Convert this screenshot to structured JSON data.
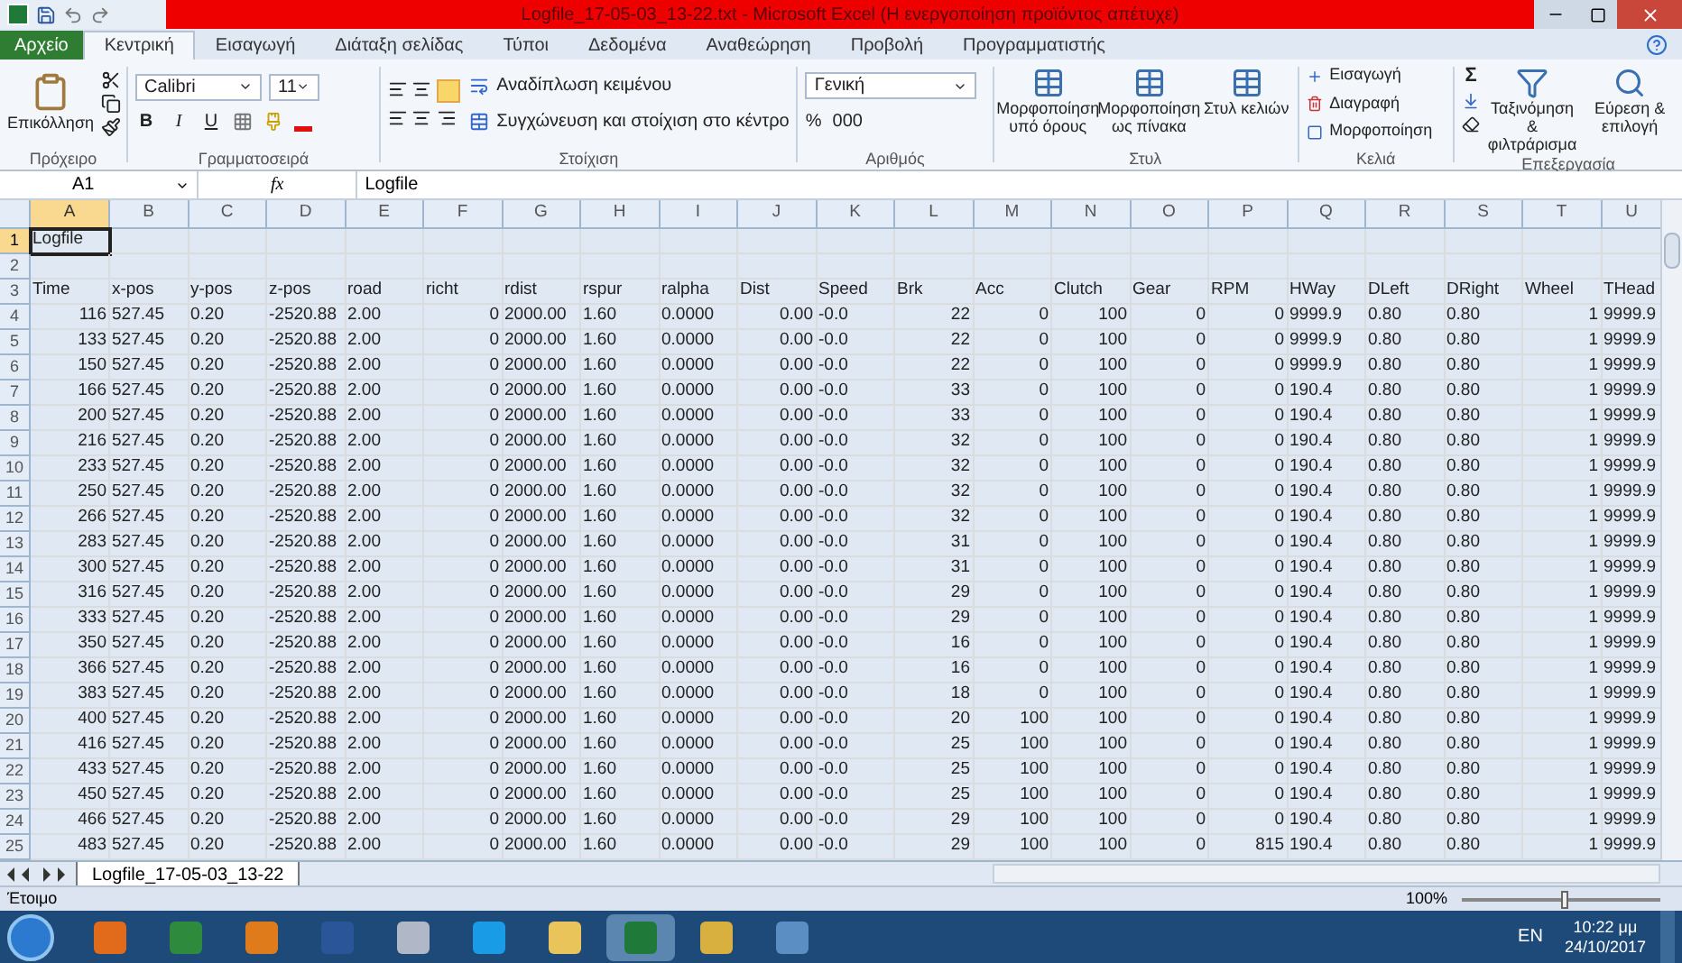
{
  "window": {
    "title": "Logfile_17-05-03_13-22.txt - Microsoft Excel (Η ενεργοποίηση προϊόντος απέτυχε)"
  },
  "ribbon": {
    "file_tab": "Αρχείο",
    "tabs": [
      {
        "label": "Κεντρική",
        "selected": true
      },
      {
        "label": "Εισαγωγή",
        "selected": false
      },
      {
        "label": "Διάταξη σελίδας",
        "selected": false
      },
      {
        "label": "Τύποι",
        "selected": false
      },
      {
        "label": "Δεδομένα",
        "selected": false
      },
      {
        "label": "Αναθεώρηση",
        "selected": false
      },
      {
        "label": "Προβολή",
        "selected": false
      },
      {
        "label": "Προγραμματιστής",
        "selected": false
      }
    ],
    "clipboard": {
      "paste": "Επικόλληση",
      "label": "Πρόχειρο"
    },
    "font": {
      "name": "Calibri",
      "size": "11",
      "bold": "B",
      "italic": "I",
      "underline": "U",
      "label": "Γραμματοσειρά"
    },
    "alignment": {
      "wrap": "Αναδίπλωση κειμένου",
      "merge": "Συγχώνευση και στοίχιση στο κέντρο",
      "label": "Στοίχιση"
    },
    "number": {
      "format": "Γενική",
      "percent": "%",
      "thousands": "000",
      "label": "Αριθμός"
    },
    "styles": {
      "buttons": [
        "Μορφοποίηση υπό όρους",
        "Μορφοποίηση ως πίνακα",
        "Στυλ κελιών"
      ],
      "label": "Στυλ"
    },
    "cells": {
      "buttons": [
        "Εισαγωγή",
        "Διαγραφή",
        "Μορφοποίηση"
      ],
      "label": "Κελιά"
    },
    "editing": {
      "sum": "Σ",
      "buttons": [
        "Ταξινόμηση & φιλτράρισμα",
        "Εύρεση & επιλογή"
      ],
      "label": "Επεξεργασία"
    }
  },
  "formula_bar": {
    "name_box": "A1",
    "fx": "fx",
    "value": "Logfile"
  },
  "sheet": {
    "columns": [
      {
        "letter": "A",
        "selected": true
      },
      {
        "letter": "B",
        "selected": false
      },
      {
        "letter": "C",
        "selected": false
      },
      {
        "letter": "D",
        "selected": false
      },
      {
        "letter": "E",
        "selected": false
      },
      {
        "letter": "F",
        "selected": false
      },
      {
        "letter": "G",
        "selected": false
      },
      {
        "letter": "H",
        "selected": false
      },
      {
        "letter": "I",
        "selected": false
      },
      {
        "letter": "J",
        "selected": false
      },
      {
        "letter": "K",
        "selected": false
      },
      {
        "letter": "L",
        "selected": false
      },
      {
        "letter": "M",
        "selected": false
      },
      {
        "letter": "N",
        "selected": false
      },
      {
        "letter": "O",
        "selected": false
      },
      {
        "letter": "P",
        "selected": false
      },
      {
        "letter": "Q",
        "selected": false
      },
      {
        "letter": "R",
        "selected": false
      },
      {
        "letter": "S",
        "selected": false
      },
      {
        "letter": "T",
        "selected": false
      },
      {
        "letter": "U",
        "selected": false
      }
    ],
    "rows": [
      {
        "number": "1",
        "kind": "text",
        "selected": true,
        "cells": [
          "Logfile"
        ]
      },
      {
        "number": "2",
        "kind": "text",
        "selected": false
      },
      {
        "number": "3",
        "kind": "text",
        "selected": false,
        "cells": [
          "Time",
          "x-pos",
          "y-pos",
          "z-pos",
          "road",
          "richt",
          "rdist",
          "rspur",
          "ralpha",
          "Dist",
          "Speed",
          "Brk",
          "Acc",
          "Clutch",
          "Gear",
          "RPM",
          "HWay",
          "DLeft",
          "DRight",
          "Wheel",
          "THead"
        ]
      },
      {
        "number": "4",
        "kind": "data",
        "selected": false,
        "cells": [
          "116",
          "527.45",
          "0.20",
          "-2520.88",
          "2.00",
          "0",
          "2000.00",
          "1.60",
          "0.0000",
          "0.00",
          "-0.0",
          "22",
          "0",
          "100",
          "0",
          "0",
          "9999.9",
          "0.80",
          "0.80",
          "1",
          "9999.9"
        ]
      },
      {
        "number": "5",
        "kind": "data",
        "selected": false,
        "cells": [
          "133",
          "527.45",
          "0.20",
          "-2520.88",
          "2.00",
          "0",
          "2000.00",
          "1.60",
          "0.0000",
          "0.00",
          "-0.0",
          "22",
          "0",
          "100",
          "0",
          "0",
          "9999.9",
          "0.80",
          "0.80",
          "1",
          "9999.9"
        ]
      },
      {
        "number": "6",
        "kind": "data",
        "selected": false,
        "cells": [
          "150",
          "527.45",
          "0.20",
          "-2520.88",
          "2.00",
          "0",
          "2000.00",
          "1.60",
          "0.0000",
          "0.00",
          "-0.0",
          "22",
          "0",
          "100",
          "0",
          "0",
          "9999.9",
          "0.80",
          "0.80",
          "1",
          "9999.9"
        ]
      },
      {
        "number": "7",
        "kind": "data",
        "selected": false,
        "cells": [
          "166",
          "527.45",
          "0.20",
          "-2520.88",
          "2.00",
          "0",
          "2000.00",
          "1.60",
          "0.0000",
          "0.00",
          "-0.0",
          "33",
          "0",
          "100",
          "0",
          "0",
          "190.4",
          "0.80",
          "0.80",
          "1",
          "9999.9"
        ]
      },
      {
        "number": "8",
        "kind": "data",
        "selected": false,
        "cells": [
          "200",
          "527.45",
          "0.20",
          "-2520.88",
          "2.00",
          "0",
          "2000.00",
          "1.60",
          "0.0000",
          "0.00",
          "-0.0",
          "33",
          "0",
          "100",
          "0",
          "0",
          "190.4",
          "0.80",
          "0.80",
          "1",
          "9999.9"
        ]
      },
      {
        "number": "9",
        "kind": "data",
        "selected": false,
        "cells": [
          "216",
          "527.45",
          "0.20",
          "-2520.88",
          "2.00",
          "0",
          "2000.00",
          "1.60",
          "0.0000",
          "0.00",
          "-0.0",
          "32",
          "0",
          "100",
          "0",
          "0",
          "190.4",
          "0.80",
          "0.80",
          "1",
          "9999.9"
        ]
      },
      {
        "number": "10",
        "kind": "data",
        "selected": false,
        "cells": [
          "233",
          "527.45",
          "0.20",
          "-2520.88",
          "2.00",
          "0",
          "2000.00",
          "1.60",
          "0.0000",
          "0.00",
          "-0.0",
          "32",
          "0",
          "100",
          "0",
          "0",
          "190.4",
          "0.80",
          "0.80",
          "1",
          "9999.9"
        ]
      },
      {
        "number": "11",
        "kind": "data",
        "selected": false,
        "cells": [
          "250",
          "527.45",
          "0.20",
          "-2520.88",
          "2.00",
          "0",
          "2000.00",
          "1.60",
          "0.0000",
          "0.00",
          "-0.0",
          "32",
          "0",
          "100",
          "0",
          "0",
          "190.4",
          "0.80",
          "0.80",
          "1",
          "9999.9"
        ]
      },
      {
        "number": "12",
        "kind": "data",
        "selected": false,
        "cells": [
          "266",
          "527.45",
          "0.20",
          "-2520.88",
          "2.00",
          "0",
          "2000.00",
          "1.60",
          "0.0000",
          "0.00",
          "-0.0",
          "32",
          "0",
          "100",
          "0",
          "0",
          "190.4",
          "0.80",
          "0.80",
          "1",
          "9999.9"
        ]
      },
      {
        "number": "13",
        "kind": "data",
        "selected": false,
        "cells": [
          "283",
          "527.45",
          "0.20",
          "-2520.88",
          "2.00",
          "0",
          "2000.00",
          "1.60",
          "0.0000",
          "0.00",
          "-0.0",
          "31",
          "0",
          "100",
          "0",
          "0",
          "190.4",
          "0.80",
          "0.80",
          "1",
          "9999.9"
        ]
      },
      {
        "number": "14",
        "kind": "data",
        "selected": false,
        "cells": [
          "300",
          "527.45",
          "0.20",
          "-2520.88",
          "2.00",
          "0",
          "2000.00",
          "1.60",
          "0.0000",
          "0.00",
          "-0.0",
          "31",
          "0",
          "100",
          "0",
          "0",
          "190.4",
          "0.80",
          "0.80",
          "1",
          "9999.9"
        ]
      },
      {
        "number": "15",
        "kind": "data",
        "selected": false,
        "cells": [
          "316",
          "527.45",
          "0.20",
          "-2520.88",
          "2.00",
          "0",
          "2000.00",
          "1.60",
          "0.0000",
          "0.00",
          "-0.0",
          "29",
          "0",
          "100",
          "0",
          "0",
          "190.4",
          "0.80",
          "0.80",
          "1",
          "9999.9"
        ]
      },
      {
        "number": "16",
        "kind": "data",
        "selected": false,
        "cells": [
          "333",
          "527.45",
          "0.20",
          "-2520.88",
          "2.00",
          "0",
          "2000.00",
          "1.60",
          "0.0000",
          "0.00",
          "-0.0",
          "29",
          "0",
          "100",
          "0",
          "0",
          "190.4",
          "0.80",
          "0.80",
          "1",
          "9999.9"
        ]
      },
      {
        "number": "17",
        "kind": "data",
        "selected": false,
        "cells": [
          "350",
          "527.45",
          "0.20",
          "-2520.88",
          "2.00",
          "0",
          "2000.00",
          "1.60",
          "0.0000",
          "0.00",
          "-0.0",
          "16",
          "0",
          "100",
          "0",
          "0",
          "190.4",
          "0.80",
          "0.80",
          "1",
          "9999.9"
        ]
      },
      {
        "number": "18",
        "kind": "data",
        "selected": false,
        "cells": [
          "366",
          "527.45",
          "0.20",
          "-2520.88",
          "2.00",
          "0",
          "2000.00",
          "1.60",
          "0.0000",
          "0.00",
          "-0.0",
          "16",
          "0",
          "100",
          "0",
          "0",
          "190.4",
          "0.80",
          "0.80",
          "1",
          "9999.9"
        ]
      },
      {
        "number": "19",
        "kind": "data",
        "selected": false,
        "cells": [
          "383",
          "527.45",
          "0.20",
          "-2520.88",
          "2.00",
          "0",
          "2000.00",
          "1.60",
          "0.0000",
          "0.00",
          "-0.0",
          "18",
          "0",
          "100",
          "0",
          "0",
          "190.4",
          "0.80",
          "0.80",
          "1",
          "9999.9"
        ]
      },
      {
        "number": "20",
        "kind": "data",
        "selected": false,
        "cells": [
          "400",
          "527.45",
          "0.20",
          "-2520.88",
          "2.00",
          "0",
          "2000.00",
          "1.60",
          "0.0000",
          "0.00",
          "-0.0",
          "20",
          "100",
          "100",
          "0",
          "0",
          "190.4",
          "0.80",
          "0.80",
          "1",
          "9999.9"
        ]
      },
      {
        "number": "21",
        "kind": "data",
        "selected": false,
        "cells": [
          "416",
          "527.45",
          "0.20",
          "-2520.88",
          "2.00",
          "0",
          "2000.00",
          "1.60",
          "0.0000",
          "0.00",
          "-0.0",
          "25",
          "100",
          "100",
          "0",
          "0",
          "190.4",
          "0.80",
          "0.80",
          "1",
          "9999.9"
        ]
      },
      {
        "number": "22",
        "kind": "data",
        "selected": false,
        "cells": [
          "433",
          "527.45",
          "0.20",
          "-2520.88",
          "2.00",
          "0",
          "2000.00",
          "1.60",
          "0.0000",
          "0.00",
          "-0.0",
          "25",
          "100",
          "100",
          "0",
          "0",
          "190.4",
          "0.80",
          "0.80",
          "1",
          "9999.9"
        ]
      },
      {
        "number": "23",
        "kind": "data",
        "selected": false,
        "cells": [
          "450",
          "527.45",
          "0.20",
          "-2520.88",
          "2.00",
          "0",
          "2000.00",
          "1.60",
          "0.0000",
          "0.00",
          "-0.0",
          "25",
          "100",
          "100",
          "0",
          "0",
          "190.4",
          "0.80",
          "0.80",
          "1",
          "9999.9"
        ]
      },
      {
        "number": "24",
        "kind": "data",
        "selected": false,
        "cells": [
          "466",
          "527.45",
          "0.20",
          "-2520.88",
          "2.00",
          "0",
          "2000.00",
          "1.60",
          "0.0000",
          "0.00",
          "-0.0",
          "29",
          "100",
          "100",
          "0",
          "0",
          "190.4",
          "0.80",
          "0.80",
          "1",
          "9999.9"
        ]
      },
      {
        "number": "25",
        "kind": "data",
        "selected": false,
        "cells": [
          "483",
          "527.45",
          "0.20",
          "-2520.88",
          "2.00",
          "0",
          "2000.00",
          "1.60",
          "0.0000",
          "0.00",
          "-0.0",
          "29",
          "100",
          "100",
          "0",
          "815",
          "190.4",
          "0.80",
          "0.80",
          "1",
          "9999.9"
        ]
      }
    ],
    "sheet_tabs": [
      {
        "label": "Logfile_17-05-03_13-22",
        "selected": true
      }
    ]
  },
  "status_bar": {
    "text": "Έτοιμο",
    "zoom": "100%",
    "zoom_slider": {
      "level": 0.5
    }
  },
  "taskbar": {
    "language": "EN",
    "time": "10:22 μμ",
    "date": "24/10/2017"
  }
}
